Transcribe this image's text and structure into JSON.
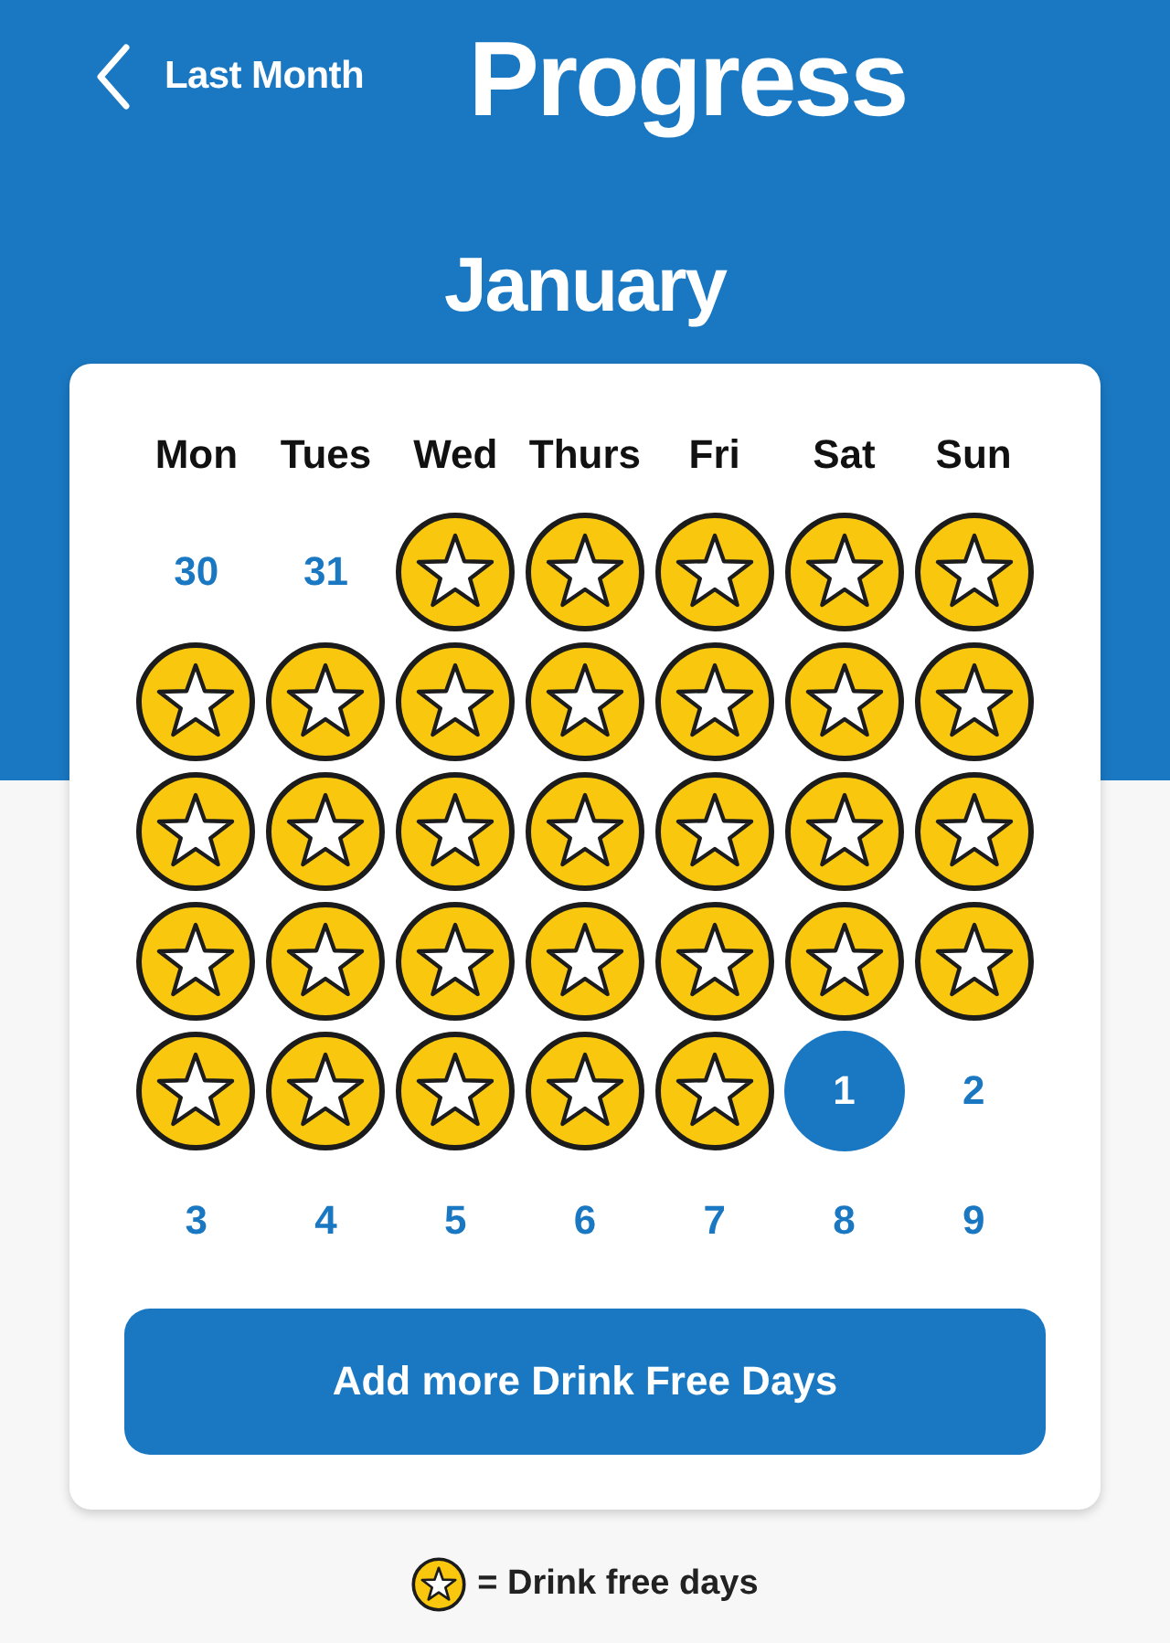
{
  "header": {
    "back_label": "Last Month",
    "title": "Progress"
  },
  "month": "January",
  "calendar": {
    "weekdays": [
      "Mon",
      "Tues",
      "Wed",
      "Thurs",
      "Fri",
      "Sat",
      "Sun"
    ],
    "days": [
      {
        "kind": "date",
        "label": "30",
        "selected": false
      },
      {
        "kind": "date",
        "label": "31",
        "selected": false
      },
      {
        "kind": "star",
        "selected": false
      },
      {
        "kind": "star",
        "selected": false
      },
      {
        "kind": "star",
        "selected": false
      },
      {
        "kind": "star",
        "selected": false
      },
      {
        "kind": "star",
        "selected": false
      },
      {
        "kind": "star",
        "selected": false
      },
      {
        "kind": "star",
        "selected": false
      },
      {
        "kind": "star",
        "selected": false
      },
      {
        "kind": "star",
        "selected": false
      },
      {
        "kind": "star",
        "selected": false
      },
      {
        "kind": "star",
        "selected": false
      },
      {
        "kind": "star",
        "selected": false
      },
      {
        "kind": "star",
        "selected": false
      },
      {
        "kind": "star",
        "selected": false
      },
      {
        "kind": "star",
        "selected": false
      },
      {
        "kind": "star",
        "selected": false
      },
      {
        "kind": "star",
        "selected": false
      },
      {
        "kind": "star",
        "selected": false
      },
      {
        "kind": "star",
        "selected": false
      },
      {
        "kind": "star",
        "selected": false
      },
      {
        "kind": "star",
        "selected": false
      },
      {
        "kind": "star",
        "selected": false
      },
      {
        "kind": "star",
        "selected": false
      },
      {
        "kind": "star",
        "selected": false
      },
      {
        "kind": "star",
        "selected": false
      },
      {
        "kind": "star",
        "selected": false
      },
      {
        "kind": "star",
        "selected": false
      },
      {
        "kind": "star",
        "selected": false
      },
      {
        "kind": "star",
        "selected": false
      },
      {
        "kind": "star",
        "selected": false
      },
      {
        "kind": "star",
        "selected": false
      },
      {
        "kind": "date",
        "label": "1",
        "selected": true
      },
      {
        "kind": "date",
        "label": "2",
        "selected": false
      },
      {
        "kind": "date",
        "label": "3",
        "selected": false
      },
      {
        "kind": "date",
        "label": "4",
        "selected": false
      },
      {
        "kind": "date",
        "label": "5",
        "selected": false
      },
      {
        "kind": "date",
        "label": "6",
        "selected": false
      },
      {
        "kind": "date",
        "label": "7",
        "selected": false
      },
      {
        "kind": "date",
        "label": "8",
        "selected": false
      },
      {
        "kind": "date",
        "label": "9",
        "selected": false
      }
    ]
  },
  "button": {
    "label": "Add more Drink Free Days"
  },
  "legend": {
    "label": "= Drink free days"
  }
}
